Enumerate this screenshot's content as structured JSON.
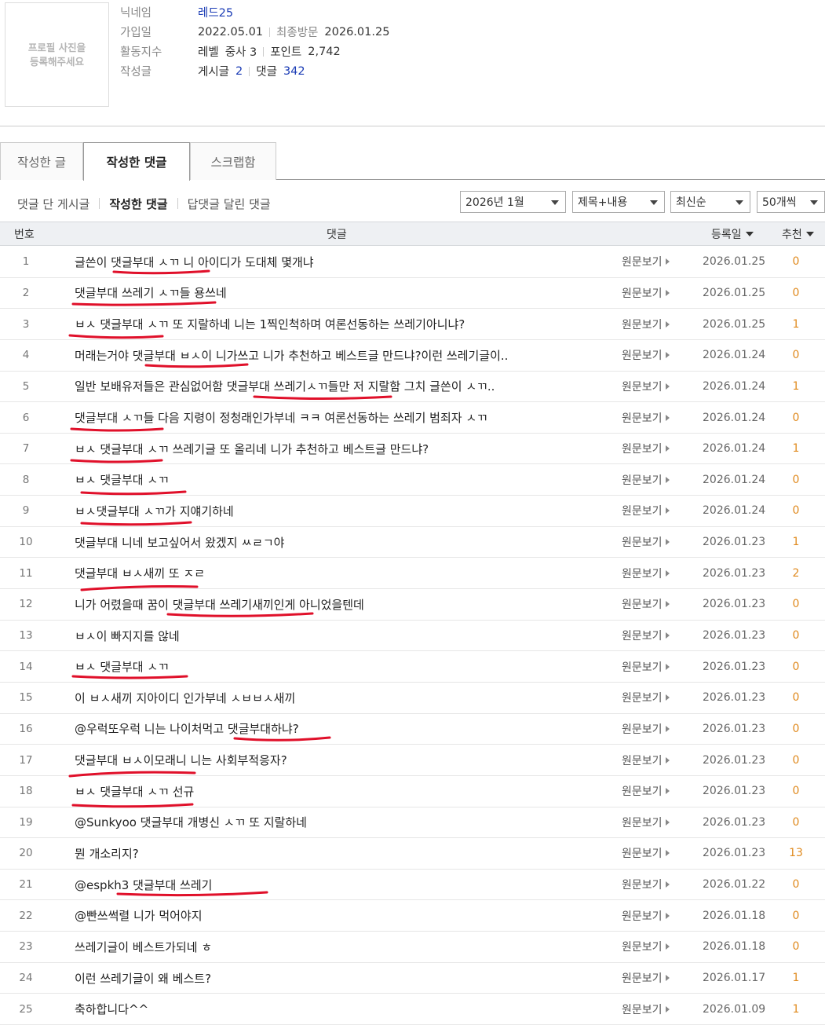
{
  "profile": {
    "photo_placeholder_line1": "프로필 사진을",
    "photo_placeholder_line2": "등록해주세요",
    "nickname_label": "닉네임",
    "nickname": "레드25",
    "join_label": "가입일",
    "join_date": "2022.05.01",
    "last_visit_label": "최종방문",
    "last_visit": "2026.01.25",
    "activity_label": "활동지수",
    "level_label": "레벨",
    "level_value": "중사 3",
    "points_label": "포인트",
    "points_value": "2,742",
    "posts_label": "작성글",
    "post_count_label": "게시글",
    "post_count": "2",
    "comment_count_label": "댓글",
    "comment_count": "342"
  },
  "tabs": [
    {
      "label": "작성한 글"
    },
    {
      "label": "작성한 댓글"
    },
    {
      "label": "스크랩함"
    }
  ],
  "subtabs": [
    {
      "label": "댓글 단 게시글"
    },
    {
      "label": "작성한 댓글"
    },
    {
      "label": "답댓글 달린 댓글"
    }
  ],
  "filters": {
    "month": "2026년 1월",
    "search_scope": "제목+내용",
    "sort": "최신순",
    "page_size": "50개씩"
  },
  "table": {
    "headers": {
      "num": "번호",
      "comment": "댓글",
      "date": "등록일",
      "recommend": "추천"
    },
    "view_label": "원문보기",
    "rows": [
      {
        "num": "1",
        "text": "글쓴이 댓글부대 ㅅㄲ 니 아이디가 도대체 몇개냐",
        "date": "2026.01.25",
        "rec": "0"
      },
      {
        "num": "2",
        "text": "댓글부대 쓰레기 ㅅㄲ들 용쓰네",
        "date": "2026.01.25",
        "rec": "0"
      },
      {
        "num": "3",
        "text": "ㅂㅅ 댓글부대 ㅅㄲ 또 지랄하네 니는 1찍인척하며 여론선동하는 쓰레기아니냐?",
        "date": "2026.01.25",
        "rec": "1"
      },
      {
        "num": "4",
        "text": "머래는거야 댓글부대 ㅂㅅ이 니가쓰고 니가 추천하고 베스트글 만드냐?이런 쓰레기글이..",
        "date": "2026.01.24",
        "rec": "0"
      },
      {
        "num": "5",
        "text": "일반 보배유저들은 관심없어함 댓글부대 쓰레기ㅅㄲ들만 저 지랄함 그치 글쓴이 ㅅㄲ..",
        "date": "2026.01.24",
        "rec": "1"
      },
      {
        "num": "6",
        "text": "댓글부대 ㅅㄲ들 다음 지령이 정청래인가부네 ㅋㅋ 여론선동하는 쓰레기 범죄자 ㅅㄲ",
        "date": "2026.01.24",
        "rec": "0"
      },
      {
        "num": "7",
        "text": "ㅂㅅ 댓글부대 ㅅㄲ 쓰레기글 또 올리네 니가 추천하고 베스트글 만드냐?",
        "date": "2026.01.24",
        "rec": "1"
      },
      {
        "num": "8",
        "text": "ㅂㅅ 댓글부대 ㅅㄲ",
        "date": "2026.01.24",
        "rec": "0"
      },
      {
        "num": "9",
        "text": "ㅂㅅ댓글부대 ㅅㄲ가 지얘기하네",
        "date": "2026.01.24",
        "rec": "0"
      },
      {
        "num": "10",
        "text": "댓글부대 니네 보고싶어서 왔겠지 ㅆㄹㄱ야",
        "date": "2026.01.23",
        "rec": "1"
      },
      {
        "num": "11",
        "text": "댓글부대 ㅂㅅ새끼 또 ㅈㄹ",
        "date": "2026.01.23",
        "rec": "2"
      },
      {
        "num": "12",
        "text": "니가 어렸을때 꿈이 댓글부대 쓰레기새끼인게 아니었을텐데",
        "date": "2026.01.23",
        "rec": "0"
      },
      {
        "num": "13",
        "text": "ㅂㅅ이 빠지지를 않네",
        "date": "2026.01.23",
        "rec": "0"
      },
      {
        "num": "14",
        "text": "ㅂㅅ 댓글부대 ㅅㄲ",
        "date": "2026.01.23",
        "rec": "0"
      },
      {
        "num": "15",
        "text": "이 ㅂㅅ새끼 지아이디 인가부네 ㅅㅂㅂㅅ새끼",
        "date": "2026.01.23",
        "rec": "0"
      },
      {
        "num": "16",
        "text": "@우럭또우럭 니는 나이처먹고 댓글부대하냐?",
        "date": "2026.01.23",
        "rec": "0"
      },
      {
        "num": "17",
        "text": "댓글부대 ㅂㅅ이모래니 니는 사회부적응자?",
        "date": "2026.01.23",
        "rec": "0"
      },
      {
        "num": "18",
        "text": "ㅂㅅ 댓글부대 ㅅㄲ 선규",
        "date": "2026.01.23",
        "rec": "0"
      },
      {
        "num": "19",
        "text": "@Sunkyoo 댓글부대 개병신 ㅅㄲ 또 지랄하네",
        "date": "2026.01.23",
        "rec": "0"
      },
      {
        "num": "20",
        "text": "뭔 개소리지?",
        "date": "2026.01.23",
        "rec": "13"
      },
      {
        "num": "21",
        "text": "@espkh3 댓글부대 쓰레기",
        "date": "2026.01.22",
        "rec": "0"
      },
      {
        "num": "22",
        "text": "@빤쓰썩렬 니가 먹어야지",
        "date": "2026.01.18",
        "rec": "0"
      },
      {
        "num": "23",
        "text": "쓰레기글이 베스트가되네 ㅎ",
        "date": "2026.01.18",
        "rec": "0"
      },
      {
        "num": "24",
        "text": "이런 쓰레기글이 왜 베스트?",
        "date": "2026.01.17",
        "rec": "1"
      },
      {
        "num": "25",
        "text": "축하합니다^^",
        "date": "2026.01.09",
        "rec": "1"
      }
    ]
  },
  "colors": {
    "link_blue": "#1a3bb5",
    "recommend_orange": "#e08a1e",
    "annotation_red": "#e0102a",
    "header_bg": "#eef0f3"
  }
}
